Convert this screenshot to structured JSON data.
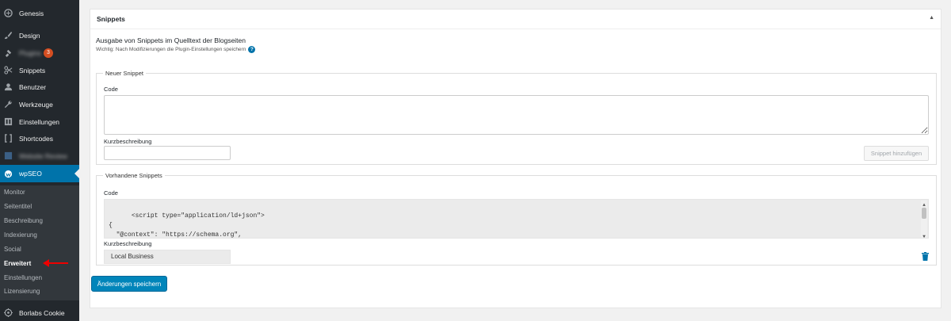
{
  "sidebar": {
    "items": [
      {
        "label": "Genesis",
        "icon": "genesis-icon"
      },
      {
        "label": "Design",
        "icon": "paintbrush-icon"
      },
      {
        "label": "Plugins",
        "icon": "plugin-icon",
        "badge": "3"
      },
      {
        "label": "Snippets",
        "icon": "scissors-icon"
      },
      {
        "label": "Benutzer",
        "icon": "user-icon"
      },
      {
        "label": "Werkzeuge",
        "icon": "wrench-icon"
      },
      {
        "label": "Einstellungen",
        "icon": "settings-icon"
      },
      {
        "label": "Shortcodes",
        "icon": "brackets-icon"
      },
      {
        "label": "Website Review",
        "icon": "chart-icon"
      },
      {
        "label": "wpSEO",
        "icon": "wpseo-icon"
      }
    ],
    "submenu": [
      "Monitor",
      "Seitentitel",
      "Beschreibung",
      "Indexierung",
      "Social",
      "Erweitert",
      "Einstellungen",
      "Lizensierung"
    ],
    "current_submenu": "Erweitert",
    "bottom_item": {
      "label": "Borlabs Cookie",
      "icon": "cookie-icon"
    }
  },
  "panel": {
    "title": "Snippets",
    "description": "Ausgabe von Snippets im Quelltext der Blogseiten",
    "note": "Wichtig: Nach Modifizierungen die Plugin-Einstellungen speichern",
    "help_icon": "?",
    "new_snippet": {
      "legend": "Neuer Snippet",
      "code_label": "Code",
      "code_value": "",
      "short_label": "Kurzbeschreibung",
      "short_value": "",
      "add_button": "Snippet hinzufügen"
    },
    "existing_snippets": {
      "legend": "Vorhandene Snippets",
      "code_label": "Code",
      "code_value": "<script type=\"application/ld+json\">\n{\n  \"@context\": \"https://schema.org\",\n  \"@type\": \"Webdesign\",",
      "short_label": "Kurzbeschreibung",
      "short_value": "Local Business"
    },
    "save_button": "Änderungen speichern"
  },
  "colors": {
    "sidebar_bg": "#23282d",
    "submenu_bg": "#32373c",
    "accent": "#0073aa",
    "button_primary": "#0085ba",
    "annotation_arrow": "#ee0000"
  }
}
